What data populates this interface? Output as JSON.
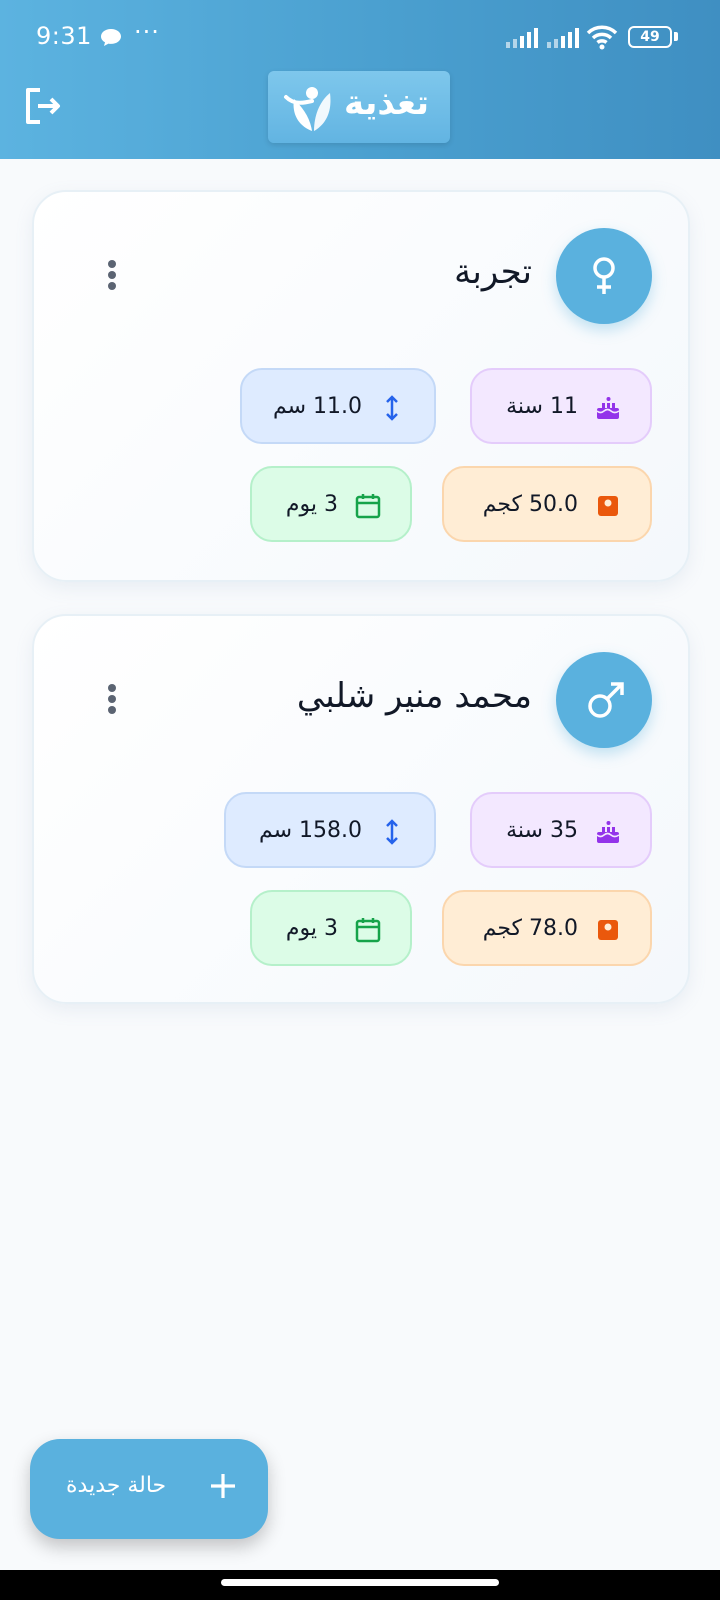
{
  "status_bar": {
    "time": "9:31",
    "dots": "···",
    "battery": "49"
  },
  "header": {
    "app_name": "تغذية"
  },
  "patients": [
    {
      "name": "تجربة",
      "gender": "female",
      "age": "11 سنة",
      "height": "11.0 سم",
      "weight": "50.0 كجم",
      "days": "3 يوم"
    },
    {
      "name": "محمد منير شلبي",
      "gender": "male",
      "age": "35 سنة",
      "height": "158.0 سم",
      "weight": "78.0 كجم",
      "days": "3 يوم"
    }
  ],
  "fab": {
    "label": "حالة جديدة"
  },
  "icons": {
    "logout": "logout-icon",
    "female": "female-icon",
    "male": "male-icon",
    "more": "more-vertical-icon",
    "age": "cake-icon",
    "height": "height-arrows-icon",
    "weight": "scale-icon",
    "days": "calendar-icon",
    "add": "plus-icon"
  },
  "colors": {
    "header_start": "#5cb3e0",
    "header_end": "#3f8fc2",
    "accent": "#5ab1de",
    "age_icon": "#9333ea",
    "height_icon": "#2563eb",
    "weight_icon": "#ea580c",
    "days_icon": "#16a34a"
  }
}
